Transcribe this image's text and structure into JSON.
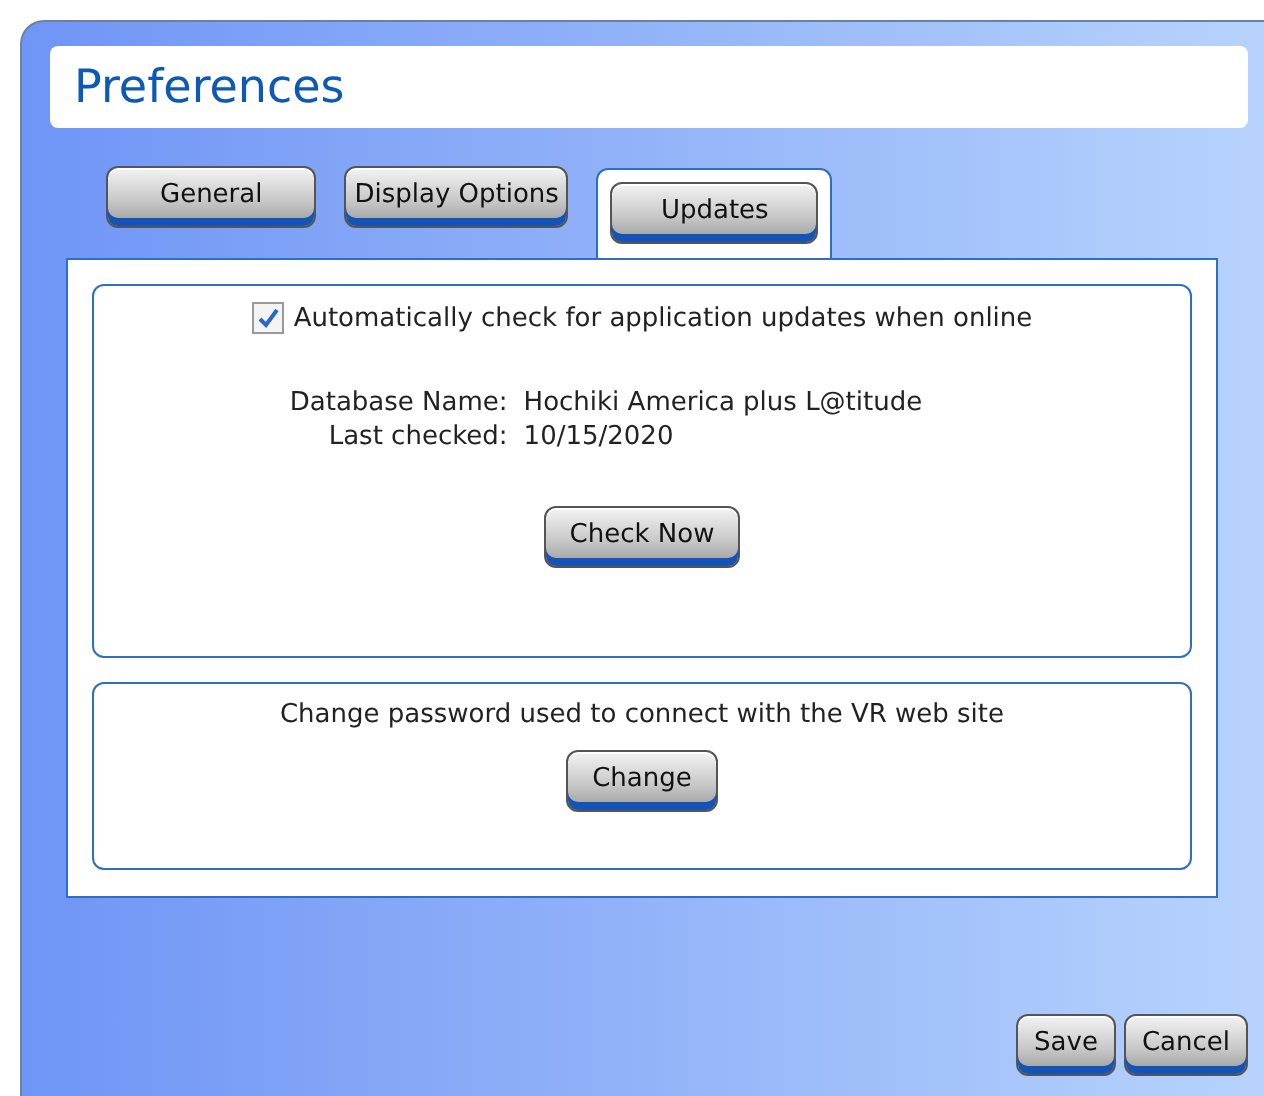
{
  "window": {
    "title": "Preferences"
  },
  "tabs": [
    {
      "label": "General",
      "selected": false
    },
    {
      "label": "Display Options",
      "selected": false
    },
    {
      "label": "Updates",
      "selected": true
    }
  ],
  "updates": {
    "auto_check": {
      "label": "Automatically check for application updates when online",
      "checked": true
    },
    "fields": [
      {
        "label": "Database Name:",
        "value": "Hochiki America plus L@titude"
      },
      {
        "label": "Last checked:",
        "value": "10/15/2020"
      }
    ],
    "check_button": "Check Now"
  },
  "password": {
    "text": "Change password used to connect with the VR web site",
    "button": "Change"
  },
  "buttons": [
    "Save",
    "Cancel"
  ]
}
